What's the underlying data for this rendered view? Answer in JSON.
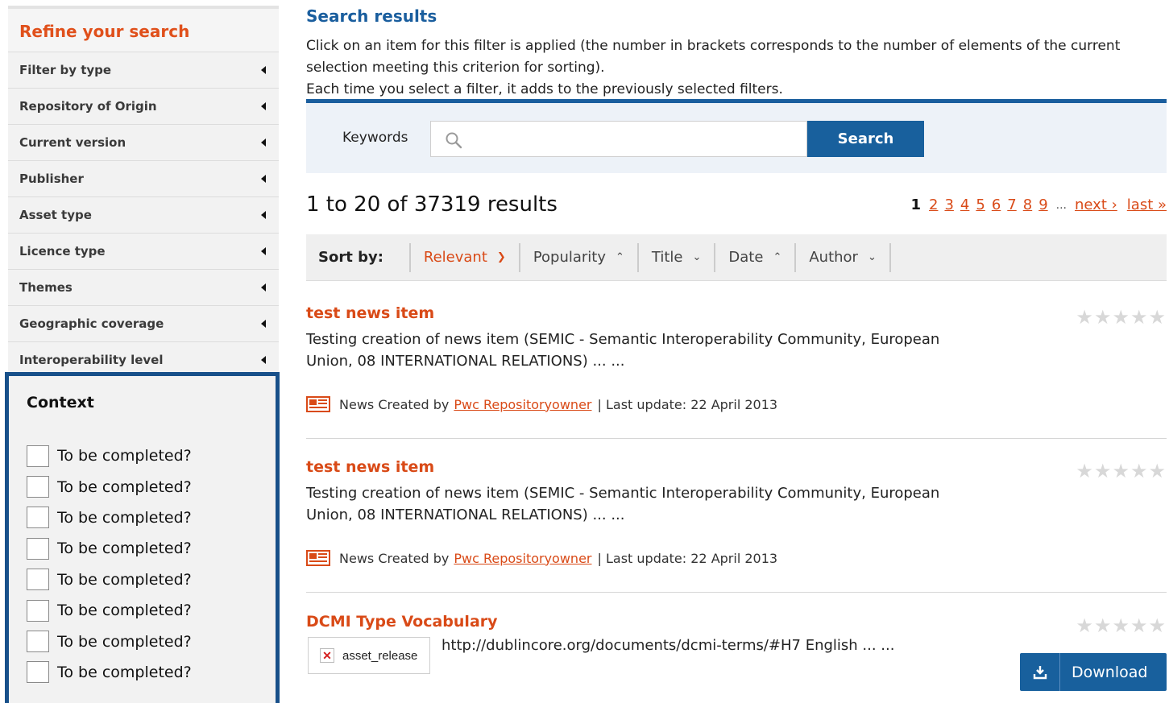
{
  "sidebar": {
    "title": "Refine your search",
    "filters": [
      {
        "label": "Filter by type"
      },
      {
        "label": "Repository of Origin"
      },
      {
        "label": "Current version"
      },
      {
        "label": "Publisher"
      },
      {
        "label": "Asset type"
      },
      {
        "label": "Licence type"
      },
      {
        "label": "Themes"
      },
      {
        "label": "Geographic coverage"
      },
      {
        "label": "Interoperability level"
      }
    ],
    "context": {
      "title": "Context",
      "options": [
        {
          "label": "To be completed?",
          "checked": false
        },
        {
          "label": "To be completed?",
          "checked": false
        },
        {
          "label": "To be completed?",
          "checked": false
        },
        {
          "label": "To be completed?",
          "checked": false
        },
        {
          "label": "To be completed?",
          "checked": false
        },
        {
          "label": "To be completed?",
          "checked": false
        },
        {
          "label": "To be completed?",
          "checked": false
        },
        {
          "label": "To be completed?",
          "checked": false
        }
      ]
    }
  },
  "main": {
    "title": "Search results",
    "intro_line1": "Click on an item for this filter is applied (the number in brackets corresponds to the number of elements of the current selection meeting this criterion for sorting).",
    "intro_line2": "Each time you select a filter, it adds to the previously selected filters.",
    "search": {
      "label": "Keywords",
      "value": "",
      "placeholder": "",
      "button_label": "Search",
      "icon": "search-icon"
    },
    "results_count": "1 to 20 of 37319 results",
    "pager": {
      "current": "1",
      "pages": [
        "2",
        "3",
        "4",
        "5",
        "6",
        "7",
        "8",
        "9"
      ],
      "ellipsis": "...",
      "next": "next ›",
      "last": "last »"
    },
    "sort": {
      "label": "Sort by:",
      "options": [
        {
          "label": "Relevant",
          "arrow": "down",
          "active": true
        },
        {
          "label": "Popularity",
          "arrow": "up",
          "active": false
        },
        {
          "label": "Title",
          "arrow": "down",
          "active": false
        },
        {
          "label": "Date",
          "arrow": "up",
          "active": false
        },
        {
          "label": "Author",
          "arrow": "down",
          "active": false
        }
      ]
    },
    "results": [
      {
        "title": "test news item",
        "description": "Testing creation of news item (SEMIC - Semantic Interoperability Community, European Union, 08 INTERNATIONAL RELATIONS) ... ...",
        "meta_prefix": "News Created by",
        "author": "Pwc Repositoryowner",
        "meta_suffix": "| Last update: 22 April 2013",
        "stars": "★★★★★",
        "rating": 0
      },
      {
        "title": "test news item",
        "description": "Testing creation of news item (SEMIC - Semantic Interoperability Community, European Union, 08 INTERNATIONAL RELATIONS) ... ...",
        "meta_prefix": "News Created by",
        "author": "Pwc Repositoryowner",
        "meta_suffix": "| Last update: 22 April 2013",
        "stars": "★★★★★",
        "rating": 0
      },
      {
        "title": "DCMI Type Vocabulary",
        "image_alt": "asset_release",
        "url_text": "http://dublincore.org/documents/dcmi-terms/#H7 English ... ...",
        "stars": "★★★★★",
        "rating": 0,
        "download_label": "Download"
      }
    ],
    "colors": {
      "accent_orange": "#d94a17",
      "brand_blue": "#18609d",
      "context_border": "#18508a"
    }
  }
}
